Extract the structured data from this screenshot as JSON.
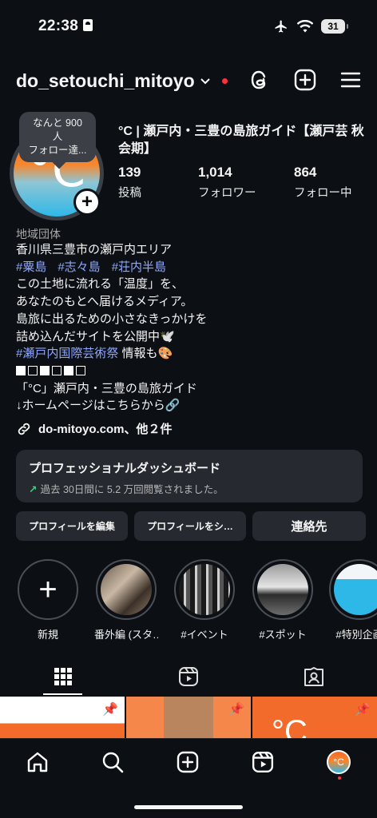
{
  "status": {
    "time": "22:38",
    "battery": "31"
  },
  "header": {
    "username": "do_setouchi_mitoyo"
  },
  "profile": {
    "bubble": [
      "なんと 900 人",
      "フォロー達..."
    ],
    "name": "°C | 瀬戸内・三豊の島旅ガイド【瀬戸芸 秋会期】",
    "avatar_text": "°C",
    "stats": [
      {
        "num": "139",
        "label": "投稿"
      },
      {
        "num": "1,014",
        "label": "フォロワー"
      },
      {
        "num": "864",
        "label": "フォロー中"
      }
    ]
  },
  "bio": {
    "category": "地域団体",
    "line1": "香川県三豊市の瀬戸内エリア",
    "tags": [
      "#粟島",
      "#志々島",
      "#荘内半島"
    ],
    "line2": "この土地に流れる「温度」を、",
    "line3": "あなたのもとへ届けるメディア。",
    "line4": "島旅に出るための小さなきっかけを",
    "line5": "詰め込んだサイトを公開中🕊️",
    "line6_tag": "#瀬戸内国際芸術祭",
    "line6_rest": " 情報も🎨",
    "line8": "「°C」瀬戸内・三豊の島旅ガイド",
    "line9": "↓ホームページはこちらから🔗",
    "link": "do-mitoyo.com、他２件"
  },
  "dashboard": {
    "title": "プロフェッショナルダッシュボード",
    "subtitle": "過去 30日間に 5.2 万回閲覧されました。"
  },
  "buttons": {
    "edit": "プロフィールを編集",
    "share": "プロフィールをシ…",
    "contact": "連絡先"
  },
  "highlights": [
    {
      "label": "新規"
    },
    {
      "label": "番外編 (スタ…"
    },
    {
      "label": "#イベント"
    },
    {
      "label": "#スポット"
    },
    {
      "label": "#特別企画"
    }
  ],
  "colors": {
    "link": "#8fa8ff",
    "brand_orange": "#f36b2a",
    "brand_blue": "#2eb8e8",
    "notify": "#ff3040"
  }
}
